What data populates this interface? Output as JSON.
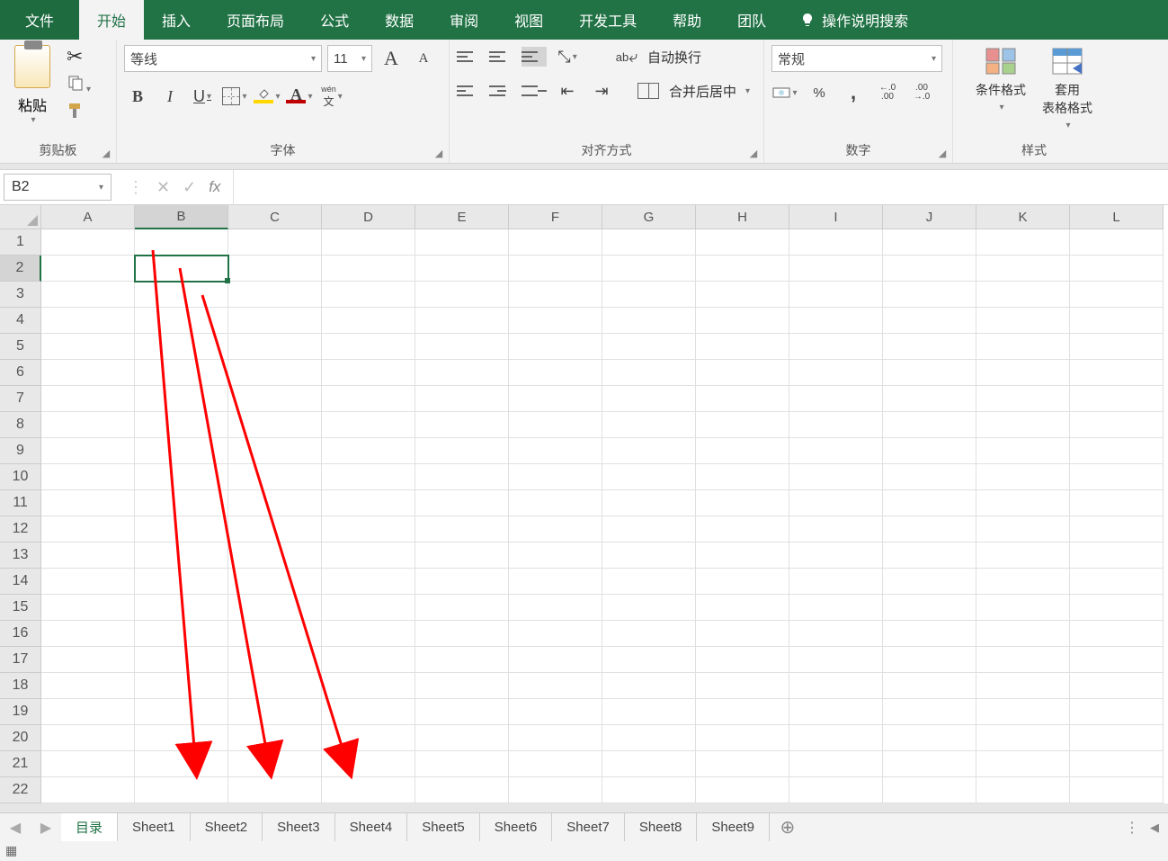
{
  "tabs": {
    "file": "文件",
    "home": "开始",
    "insert": "插入",
    "layout": "页面布局",
    "formulas": "公式",
    "data": "数据",
    "review": "审阅",
    "view": "视图",
    "developer": "开发工具",
    "help": "帮助",
    "team": "团队",
    "search": "操作说明搜索"
  },
  "clipboard": {
    "paste": "粘贴",
    "group": "剪贴板"
  },
  "font": {
    "name": "等线",
    "size": "11",
    "group": "字体",
    "wen_top": "wén",
    "wen_char": "文",
    "a": "A",
    "b": "B",
    "i": "I",
    "u": "U"
  },
  "alignment": {
    "wrap": "自动换行",
    "merge": "合并后居中",
    "group": "对齐方式",
    "ab": "ab"
  },
  "number": {
    "format": "常规",
    "group": "数字",
    "percent": "%",
    "comma": ",",
    "inc": ".0",
    "inc2": ".00",
    "dec": ".00",
    "dec2": ".0"
  },
  "styles": {
    "cond": "条件格式",
    "table": "套用\n表格格式",
    "group": "样式"
  },
  "namebox": "B2",
  "columns": [
    "A",
    "B",
    "C",
    "D",
    "E",
    "F",
    "G",
    "H",
    "I",
    "J",
    "K",
    "L"
  ],
  "rows": [
    "1",
    "2",
    "3",
    "4",
    "5",
    "6",
    "7",
    "8",
    "9",
    "10",
    "11",
    "12",
    "13",
    "14",
    "15",
    "16",
    "17",
    "18",
    "19",
    "20",
    "21",
    "22"
  ],
  "selected": {
    "col": 1,
    "row": 1
  },
  "sheets": {
    "active": "目录",
    "list": [
      "Sheet1",
      "Sheet2",
      "Sheet3",
      "Sheet4",
      "Sheet5",
      "Sheet6",
      "Sheet7",
      "Sheet8",
      "Sheet9"
    ]
  }
}
